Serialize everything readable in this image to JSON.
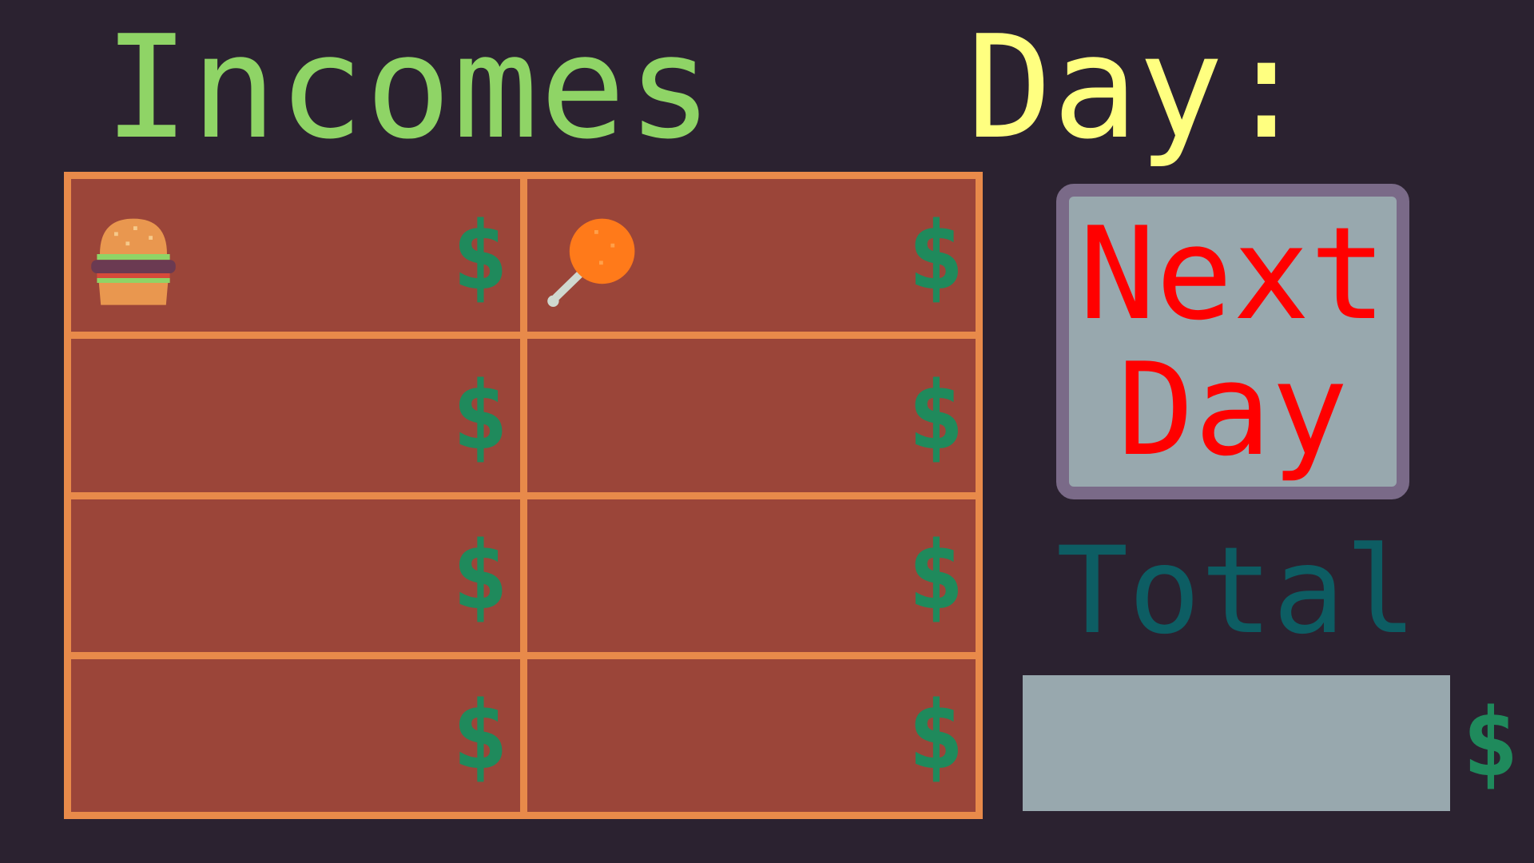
{
  "header": {
    "title": "Incomes",
    "day_label": "Day:"
  },
  "incomes": {
    "currency_symbol": "$",
    "cells": [
      {
        "icon": "burger-icon"
      },
      {
        "icon": "chicken-leg-icon"
      },
      {
        "icon": ""
      },
      {
        "icon": ""
      },
      {
        "icon": ""
      },
      {
        "icon": ""
      },
      {
        "icon": ""
      },
      {
        "icon": ""
      }
    ]
  },
  "next_day_button": {
    "line1": "Next",
    "line2": "Day"
  },
  "total": {
    "label": "Total",
    "currency_symbol": "$"
  },
  "colors": {
    "background": "#2b2230",
    "title": "#8fd466",
    "day": "#ffff80",
    "grid_border": "#e88a4a",
    "cell": "#9b4539",
    "dollar": "#1f8a5c",
    "button_text": "#ff0000",
    "total_label": "#0d5d63"
  }
}
